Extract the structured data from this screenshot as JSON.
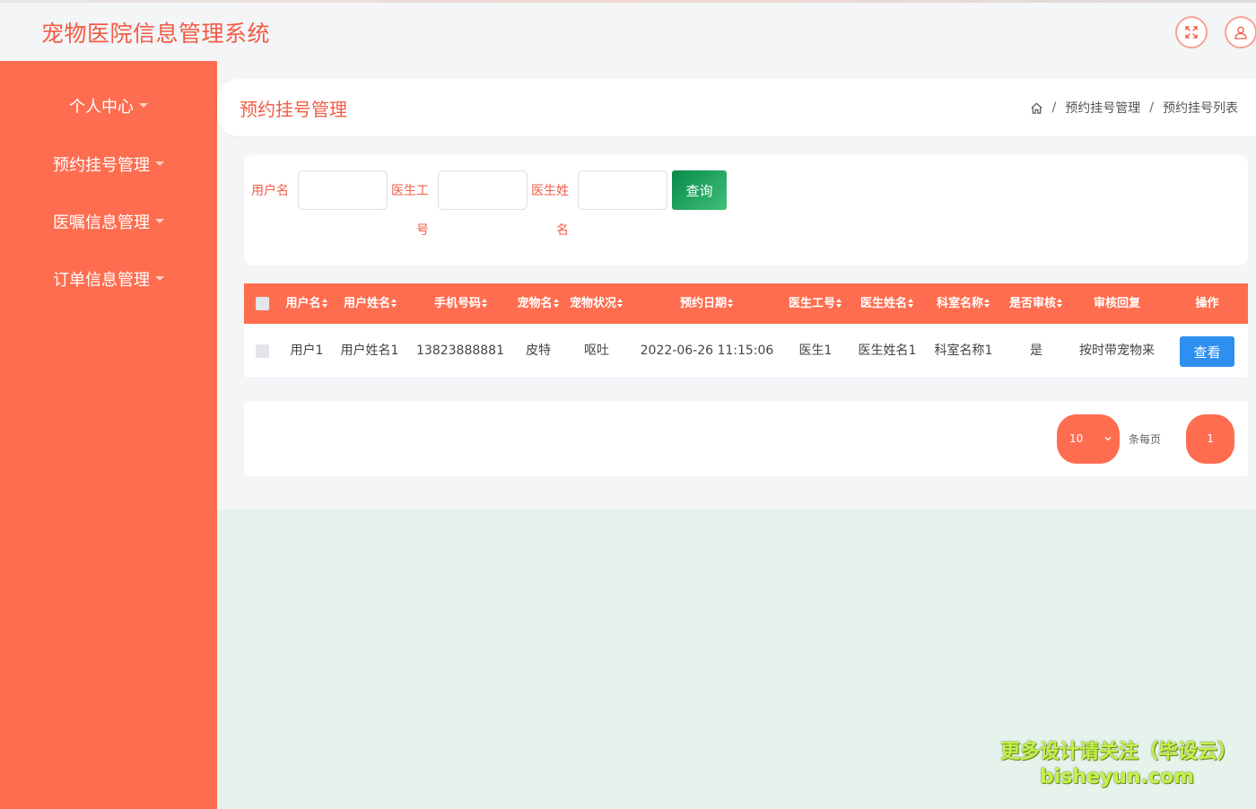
{
  "header": {
    "app_title": "宠物医院信息管理系统",
    "icons": [
      "fullscreen-icon",
      "user-icon"
    ]
  },
  "sidebar": {
    "items": [
      {
        "label": "个人中心"
      },
      {
        "label": "预约挂号管理"
      },
      {
        "label": "医嘱信息管理"
      },
      {
        "label": "订单信息管理"
      }
    ]
  },
  "page": {
    "title": "预约挂号管理",
    "breadcrumb": [
      "预约挂号管理",
      "预约挂号列表"
    ]
  },
  "search": {
    "username_label": "用户名",
    "doctor_id_label_1": "医生工",
    "doctor_id_label_2": "号",
    "doctor_name_label_1": "医生姓",
    "doctor_name_label_2": "名",
    "username_value": "",
    "doctor_id_value": "",
    "doctor_name_value": "",
    "query_button": "查询"
  },
  "table": {
    "columns": [
      "用户名",
      "用户姓名",
      "手机号码",
      "宠物名",
      "宠物状况",
      "预约日期",
      "医生工号",
      "医生姓名",
      "科室名称",
      "是否审核",
      "审核回复",
      "操作"
    ],
    "rows": [
      {
        "username": "用户1",
        "real_name": "用户姓名1",
        "phone": "13823888881",
        "pet_name": "皮特",
        "pet_status": "呕吐",
        "appointment_date": "2022-06-26 11:15:06",
        "doctor_id": "医生1",
        "doctor_name": "医生姓名1",
        "department": "科室名称1",
        "reviewed": "是",
        "review_reply": "按时带宠物来",
        "action_label": "查看"
      }
    ]
  },
  "pagination": {
    "page_size": "10",
    "per_page_label": "条每页",
    "current_page": "1"
  },
  "watermark": {
    "line1": "更多设计请关注（毕设云）",
    "line2": "bisheyun.com"
  },
  "colors": {
    "accent": "#fe6d4f",
    "title_red": "#f25c45",
    "query_green": "#0a8a4a",
    "view_blue": "#2e8ff0",
    "background": "#e6f2ec"
  }
}
